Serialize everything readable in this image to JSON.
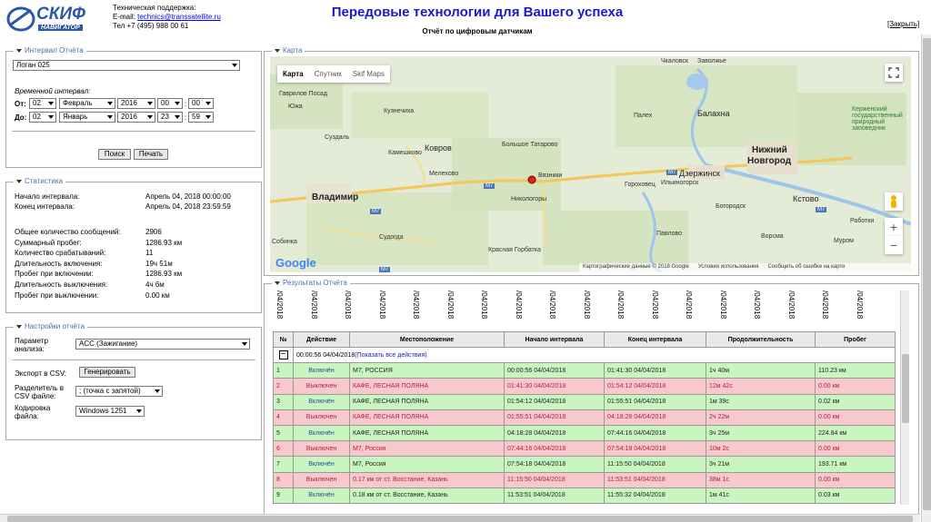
{
  "header": {
    "logo_name": "СКИФ",
    "logo_sub": "НАВИГАТОР",
    "support_label": "Техническая поддержка:",
    "email_label": "E-mail:",
    "email": "technics@transsatellite.ru",
    "phone": "Тел +7 (495) 988 00 61",
    "title": "Передовые технологии для Вашего успеха",
    "subtitle": "Отчёт по цифровым датчикам",
    "close": "[Закрыть]"
  },
  "interval": {
    "legend": "Интервал Отчёта",
    "vehicle": "Логан 025",
    "time_label": "Временной интервал:",
    "from_label": "От:",
    "to_label": "До:",
    "from": {
      "day": "02",
      "month": "Февраль",
      "year": "2016",
      "hour": "00",
      "min": "00"
    },
    "to": {
      "day": "02",
      "month": "Январь",
      "year": "2016",
      "hour": "23",
      "min": "59"
    },
    "search_btn": "Поиск",
    "print_btn": "Печать"
  },
  "stats": {
    "legend": "Статистика",
    "rows1": [
      {
        "label": "Начало интервала:",
        "value": "Апрель 04, 2018 00:00:00"
      },
      {
        "label": "Конец интервала:",
        "value": "Апрель 04, 2018 23:59:59"
      }
    ],
    "rows2": [
      {
        "label": "Общее количество сообщений:",
        "value": "2906"
      },
      {
        "label": "Суммарный пробег:",
        "value": "1286.93 км"
      },
      {
        "label": "Количество срабатываний:",
        "value": "11"
      },
      {
        "label": "Длительность включения:",
        "value": "19ч 51м"
      },
      {
        "label": "Пробег при включении:",
        "value": "1286.93 км"
      },
      {
        "label": "Длительность выключения:",
        "value": "4ч 6м"
      },
      {
        "label": "Пробег при выключении:",
        "value": "0.00 км"
      }
    ]
  },
  "settings": {
    "legend": "Настройки отчёта",
    "param_label1": "Параметр",
    "param_label2": "анализа:",
    "param_value": "ACC (Зажигание)",
    "export_label": "Экспорт в CSV:",
    "generate_btn": "Генерировать",
    "sep_label1": "Разделитель в",
    "sep_label2": "CSV файле:",
    "sep_value": "; (точка с запятой)",
    "enc_label1": "Кодировка",
    "enc_label2": "файла:",
    "enc_value": "Windows 1251"
  },
  "map": {
    "legend": "Карта",
    "tabs": [
      "Карта",
      "Спутник",
      "Skif Maps"
    ],
    "google": "Google",
    "footer": [
      "Картографические данные © 2018 Google",
      "Условия использования",
      "Сообщить об ошибке на карте"
    ],
    "cities": [
      {
        "name": "Владимир",
        "cls": "city"
      },
      {
        "name": "Нижний",
        "cls": "city"
      },
      {
        "name": "Новгород",
        "cls": "city"
      },
      {
        "name": "Дзержинск",
        "cls": "mid"
      },
      {
        "name": "Ковров",
        "cls": "mid"
      },
      {
        "name": "Балахна",
        "cls": "mid"
      },
      {
        "name": "Вязники",
        "cls": ""
      },
      {
        "name": "Гороховец",
        "cls": ""
      },
      {
        "name": "Суздаль",
        "cls": ""
      },
      {
        "name": "Кстово",
        "cls": "mid"
      },
      {
        "name": "Богородск",
        "cls": ""
      },
      {
        "name": "Павлово",
        "cls": ""
      },
      {
        "name": "Муром",
        "cls": ""
      },
      {
        "name": "Судогда",
        "cls": ""
      },
      {
        "name": "Собинка",
        "cls": ""
      },
      {
        "name": "Камешково",
        "cls": ""
      },
      {
        "name": "Мелехово",
        "cls": ""
      },
      {
        "name": "Никологоры",
        "cls": ""
      },
      {
        "name": "Большое Татарово",
        "cls": ""
      },
      {
        "name": "Красная Горбатка",
        "cls": ""
      },
      {
        "name": "Ильиногорск",
        "cls": ""
      },
      {
        "name": "Чкаловск",
        "cls": ""
      },
      {
        "name": "Заволжье",
        "cls": ""
      },
      {
        "name": "Кузнечиха",
        "cls": ""
      },
      {
        "name": "Гаврилов Посад",
        "cls": ""
      },
      {
        "name": "Южа",
        "cls": ""
      },
      {
        "name": "Палех",
        "cls": ""
      },
      {
        "name": "Керженский государственный природный заповедник",
        "cls": ""
      },
      {
        "name": "Работки",
        "cls": ""
      },
      {
        "name": "Ворсма",
        "cls": ""
      }
    ],
    "roads": [
      "M7",
      "M7",
      "M7",
      "M7",
      "M7"
    ]
  },
  "results": {
    "legend": "Результаты Отчёта",
    "rotated_heads": [
      "/04/2018",
      "/04/2018",
      "/04/2018",
      "/04/2018",
      "/04/2018",
      "/04/2018",
      "/04/2018",
      "/04/2018",
      "/04/2018",
      "/04/2018",
      "/04/2018",
      "/04/2018",
      "/04/2018",
      "/04/2018",
      "/04/2018",
      "/04/2018",
      "/04/2018",
      "/04/2018",
      "/04/2018",
      "/04/2018",
      "/04/2018",
      "/04/2018",
      "/04/2018",
      "/04/2018",
      "/04/2018",
      "/04/2018",
      "/04/2018",
      "/04/2018",
      "/04/2018",
      "/04/2018",
      "/04/2018",
      "/04/2018",
      "/04/2018",
      "/04/2018",
      "/04/2018",
      "/04/2018"
    ],
    "columns": [
      "№",
      "Действие",
      "Местоположение",
      "Начало интервала",
      "Конец интервала",
      "Продолжительность",
      "Пробег"
    ],
    "group_time": "00:00:56 04/04/2018",
    "group_link": "(Показать все действия)",
    "rows": [
      {
        "n": "1",
        "act": "Включён",
        "loc": "M7, РОССИЯ",
        "start": "00:00:56 04/04/2018",
        "end": "01:41:30 04/04/2018",
        "dur": "1ч 40м",
        "dist": "110.23 км",
        "state": "on"
      },
      {
        "n": "2",
        "act": "Выключен",
        "loc": "КАФЕ, ЛЕСНАЯ ПОЛЯНА",
        "start": "01:41:30 04/04/2018",
        "end": "01:54:12 04/04/2018",
        "dur": "12м 42с",
        "dist": "0.00 км",
        "state": "off"
      },
      {
        "n": "3",
        "act": "Включён",
        "loc": "КАФЕ, ЛЕСНАЯ ПОЛЯНА",
        "start": "01:54:12 04/04/2018",
        "end": "01:55:51 04/04/2018",
        "dur": "1м 39с",
        "dist": "0.02 км",
        "state": "on"
      },
      {
        "n": "4",
        "act": "Выключен",
        "loc": "КАФЕ, ЛЕСНАЯ ПОЛЯНА",
        "start": "01:55:51 04/04/2018",
        "end": "04:18:28 04/04/2018",
        "dur": "2ч 22м",
        "dist": "0.00 км",
        "state": "off"
      },
      {
        "n": "5",
        "act": "Включён",
        "loc": "КАФЕ, ЛЕСНАЯ ПОЛЯНА",
        "start": "04:18:28 04/04/2018",
        "end": "07:44:16 04/04/2018",
        "dur": "3ч 25м",
        "dist": "224.84 км",
        "state": "on"
      },
      {
        "n": "6",
        "act": "Выключен",
        "loc": "M7, Россия",
        "start": "07:44:16 04/04/2018",
        "end": "07:54:18 04/04/2018",
        "dur": "10м 2с",
        "dist": "0.00 км",
        "state": "off"
      },
      {
        "n": "7",
        "act": "Включён",
        "loc": "M7, Россия",
        "start": "07:54:18 04/04/2018",
        "end": "11:15:50 04/04/2018",
        "dur": "3ч 21м",
        "dist": "193.71 км",
        "state": "on"
      },
      {
        "n": "8",
        "act": "Выключен",
        "loc": "0.17 км от ст. Восстание, Казань",
        "start": "11:15:50 04/04/2018",
        "end": "11:53:51 04/04/2018",
        "dur": "38м 1с",
        "dist": "0.00 км",
        "state": "off"
      },
      {
        "n": "9",
        "act": "Включён",
        "loc": "0.18 км от ст. Восстание, Казань",
        "start": "11:53:51 04/04/2018",
        "end": "11:55:32 04/04/2018",
        "dur": "1м 41с",
        "dist": "0.03 км",
        "state": "on"
      }
    ]
  }
}
